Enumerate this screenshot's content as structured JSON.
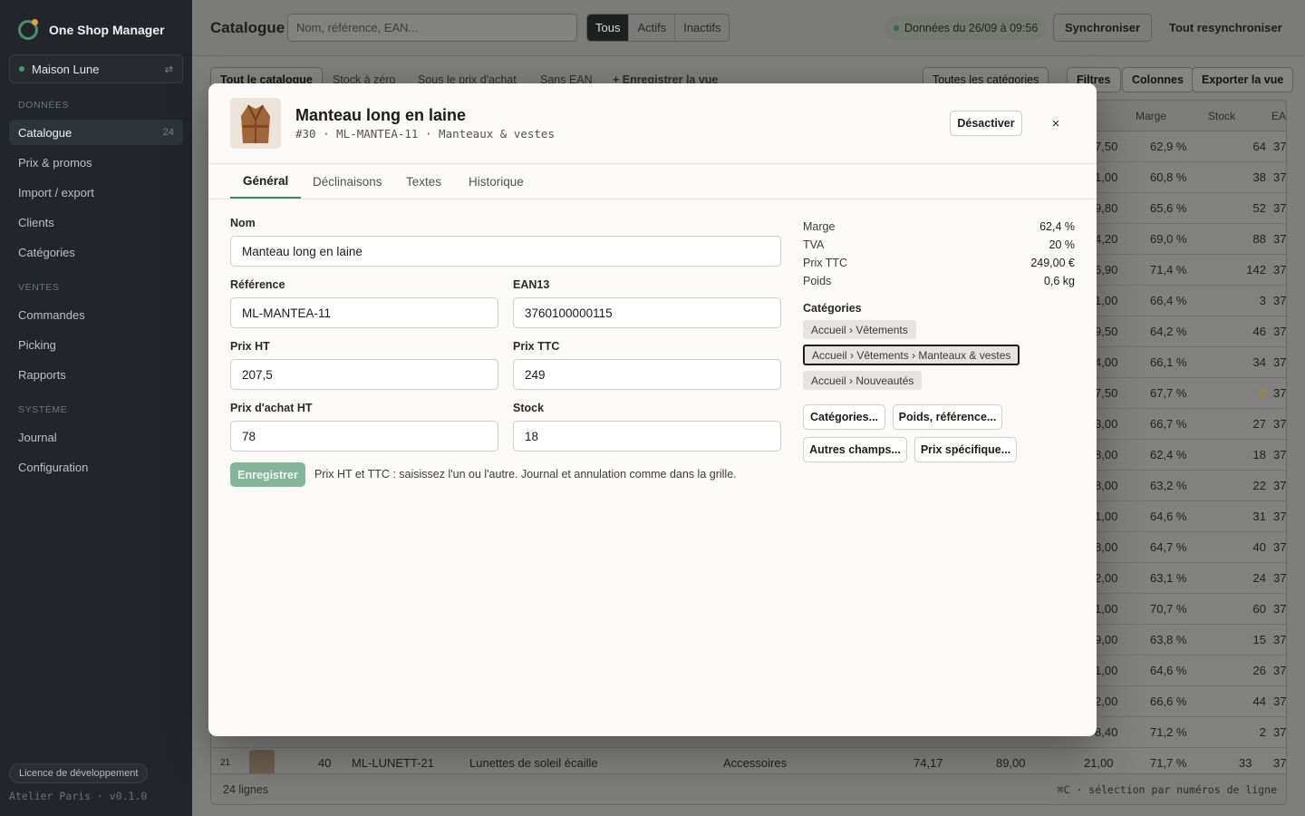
{
  "sidebar": {
    "brand": "One Shop Manager",
    "shop": "Maison Lune",
    "sections": [
      "Données",
      "Ventes",
      "Système"
    ],
    "items": [
      {
        "label": "Catalogue",
        "count": "24"
      },
      {
        "label": "Prix & promos"
      },
      {
        "label": "Import / export"
      },
      {
        "label": "Clients"
      },
      {
        "label": "Catégories"
      },
      {
        "label": "Commandes"
      },
      {
        "label": "Picking"
      },
      {
        "label": "Rapports"
      },
      {
        "label": "Journal"
      },
      {
        "label": "Configuration"
      }
    ],
    "license": "Licence de développement",
    "version": "Atelier Paris · v0.1.0"
  },
  "topbar": {
    "title": "Catalogue",
    "search_placeholder": "Nom, référence, EAN...",
    "filters": [
      "Tous",
      "Actifs",
      "Inactifs"
    ],
    "sync_status": "Données du 26/09 à 09:56",
    "sync_button": "Synchroniser",
    "resync_button": "Tout resynchroniser"
  },
  "filterbar": {
    "tabs": [
      "Tout le catalogue",
      "Stock à zéro",
      "Sous le prix d'achat",
      "Sans EAN",
      "+ Enregistrer la vue"
    ],
    "category_select": "Toutes les catégories",
    "buttons": [
      "Filtres",
      "Colonnes",
      "Exporter la vue"
    ]
  },
  "grid": {
    "headers": {
      "margin": "Marge",
      "stock": "Stock",
      "ean": "EA"
    },
    "rows": [
      {
        "price": "7,50",
        "margin": "62,9 %",
        "stock": "64",
        "ean": "37"
      },
      {
        "price": "1,00",
        "margin": "60,8 %",
        "stock": "38",
        "ean": "37"
      },
      {
        "price": "9,80",
        "margin": "65,6 %",
        "stock": "52",
        "ean": "37"
      },
      {
        "price": "4,20",
        "margin": "69,0 %",
        "stock": "88",
        "ean": "37"
      },
      {
        "price": "6,90",
        "margin": "71,4 %",
        "stock": "142",
        "ean": "37"
      },
      {
        "price": "1,00",
        "margin": "66,4 %",
        "stock": "3",
        "ean": "37"
      },
      {
        "price": "9,50",
        "margin": "64,2 %",
        "stock": "46",
        "ean": "37"
      },
      {
        "price": "4,00",
        "margin": "66,1 %",
        "stock": "34",
        "ean": "37"
      },
      {
        "price": "7,50",
        "margin": "67,7 %",
        "stock": "0",
        "ean": "37"
      },
      {
        "price": "3,00",
        "margin": "66,7 %",
        "stock": "27",
        "ean": "37"
      },
      {
        "price": "8,00",
        "margin": "62,4 %",
        "stock": "18",
        "ean": "37"
      },
      {
        "price": "8,00",
        "margin": "63,2 %",
        "stock": "22",
        "ean": "37"
      },
      {
        "price": "1,00",
        "margin": "64,6 %",
        "stock": "31",
        "ean": "37"
      },
      {
        "price": "8,00",
        "margin": "64,7 %",
        "stock": "40",
        "ean": "37"
      },
      {
        "price": "2,00",
        "margin": "63,1 %",
        "stock": "24",
        "ean": "37"
      },
      {
        "price": "1,00",
        "margin": "70,7 %",
        "stock": "60",
        "ean": "37"
      },
      {
        "price": "9,00",
        "margin": "63,8 %",
        "stock": "15",
        "ean": "37"
      },
      {
        "price": "1,00",
        "margin": "64,6 %",
        "stock": "26",
        "ean": "37"
      },
      {
        "price": "2,00",
        "margin": "66,6 %",
        "stock": "44",
        "ean": "37"
      },
      {
        "price": "8,40",
        "margin": "71,2 %",
        "stock": "2",
        "ean": "37"
      }
    ],
    "last_row": {
      "line": "21",
      "id": "40",
      "ref": "ML-LUNETT-21",
      "name": "Lunettes de soleil écaille",
      "category": "Accessoires",
      "ht": "74,17",
      "ttc": "89,00",
      "buy": "21,00",
      "margin": "71,7 %",
      "stock": "33",
      "ean": "37"
    },
    "footer_count": "24 lignes",
    "footer_hint": "⌘C · sélection par numéros de ligne"
  },
  "modal": {
    "title": "Manteau long en laine",
    "subtitle": "#30 · ML-MANTEA-11 · Manteaux & vestes",
    "deactivate": "Désactiver",
    "close": "×",
    "tabs": [
      "Général",
      "Déclinaisons",
      "Textes",
      "Historique"
    ],
    "fields": {
      "name_label": "Nom",
      "name": "Manteau long en laine",
      "ref_label": "Référence",
      "ref": "ML-MANTEA-11",
      "ean_label": "EAN13",
      "ean": "3760100000115",
      "ht_label": "Prix HT",
      "ht": "207,5",
      "ttc_label": "Prix TTC",
      "ttc": "249",
      "buy_label": "Prix d'achat HT",
      "buy": "78",
      "stock_label": "Stock",
      "stock": "18"
    },
    "save": "Enregistrer",
    "hint": "Prix HT et TTC : saisissez l'un ou l'autre. Journal et annulation comme dans la grille.",
    "summary": [
      {
        "k": "Marge",
        "v": "62,4 %"
      },
      {
        "k": "TVA",
        "v": "20 %"
      },
      {
        "k": "Prix TTC",
        "v": "249,00 €"
      },
      {
        "k": "Poids",
        "v": "0,6 kg"
      }
    ],
    "categories_title": "Catégories",
    "categories": [
      "Accueil › Vêtements",
      "Accueil › Vêtements › Manteaux & vestes",
      "Accueil › Nouveautés"
    ],
    "actions": [
      "Catégories...",
      "Poids, référence...",
      "Autres champs...",
      "Prix spécifique..."
    ]
  },
  "colors": {
    "accent": "#3c8a62",
    "sidebar": "#22262a",
    "status_green": "#3f9d69",
    "warning": "#b8860b"
  }
}
